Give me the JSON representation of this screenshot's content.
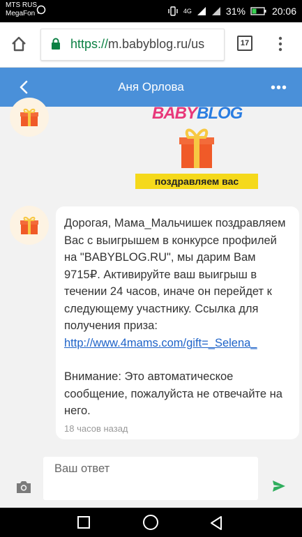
{
  "status": {
    "carrier_line1": "MTS RUS",
    "carrier_line2": "MegaFon",
    "battery": "31%",
    "time": "20:06",
    "network": "4G"
  },
  "browser": {
    "url_scheme": "https://",
    "url_rest": "m.babyblog.ru/us",
    "tab_count": "17"
  },
  "appbar": {
    "title": "Аня Орлова"
  },
  "image_message": {
    "logo_part1": "BABY",
    "logo_part2": "BLOG",
    "banner": "поздравляем вас"
  },
  "message": {
    "body": "Дорогая, Мама_Мальчишек поздравляем Вас с выигрышем в конкурсе профилей на \"BABYBLOG.RU\", мы дарим Вам 9715₽. Активируйте ваш выигрыш в течении 24 часов, иначе он перейдет к следующему участнику. Ссылка для получения приза:",
    "link": "http://www.4mams.com/gift=_Selena_",
    "notice": "Внимание: Это автоматическое сообщение, пожалуйста не отвечайте на него.",
    "time": "18 часов назад"
  },
  "composer": {
    "placeholder": "Ваш ответ"
  },
  "colors": {
    "appbar": "#4a90d9",
    "link": "#1e63c8",
    "send": "#2fae5d",
    "gift": "#f05a28"
  }
}
